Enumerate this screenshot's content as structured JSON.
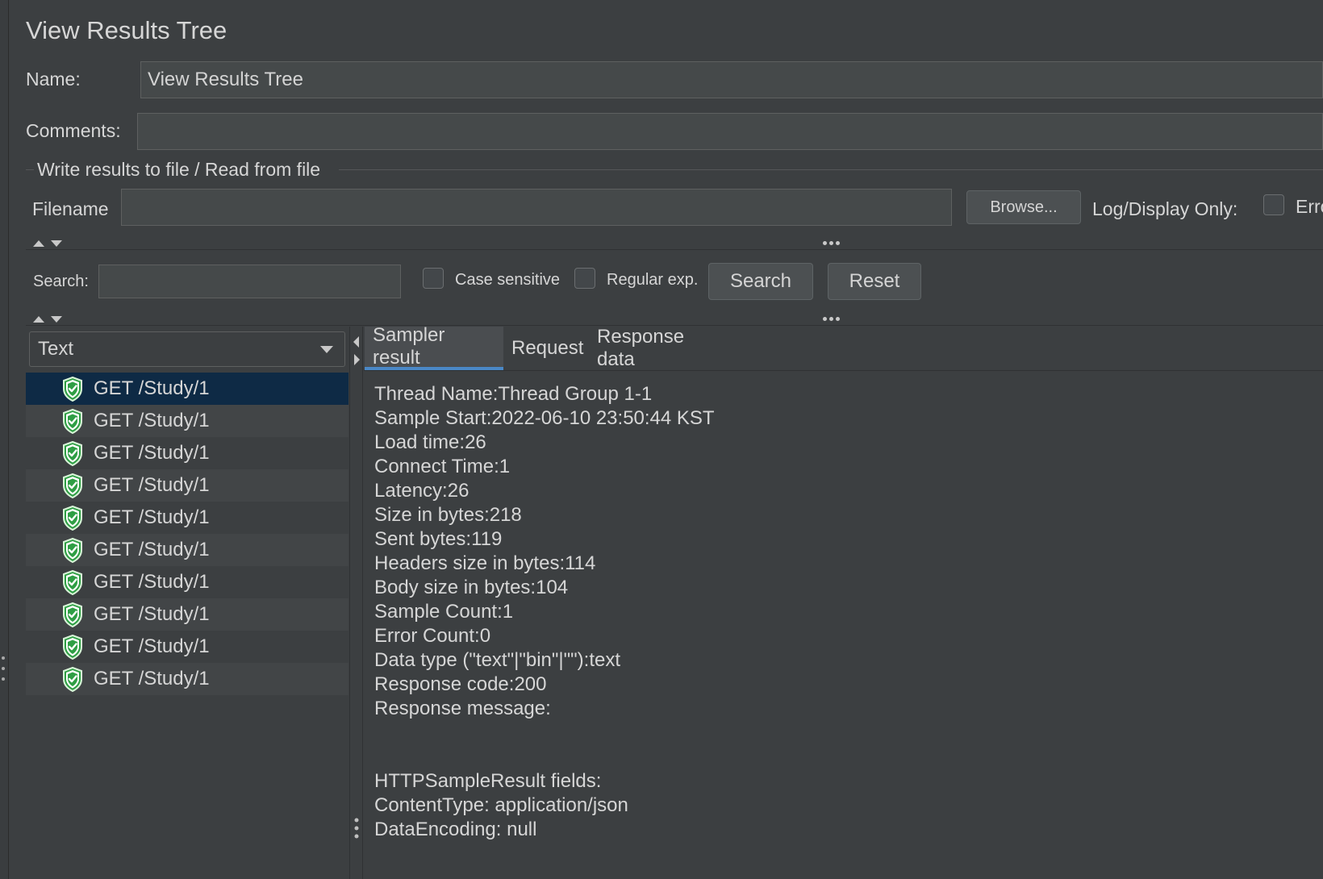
{
  "header": {
    "title": "View Results Tree"
  },
  "form": {
    "name_label": "Name:",
    "name_value": "View Results Tree",
    "comments_label": "Comments:",
    "comments_value": "",
    "file_group_title": "Write results to file / Read from file",
    "filename_label": "Filename",
    "filename_value": "",
    "browse_label": "Browse...",
    "log_display_only_label": "Log/Display Only:",
    "errors_label": "Erro"
  },
  "search": {
    "label": "Search:",
    "value": "",
    "case_sensitive_label": "Case sensitive",
    "regex_label": "Regular exp.",
    "search_button": "Search",
    "reset_button": "Reset"
  },
  "renderer": {
    "selected": "Text"
  },
  "tree": {
    "items": [
      {
        "label": "GET /Study/1",
        "status": "success",
        "selected": true
      },
      {
        "label": "GET /Study/1",
        "status": "success",
        "selected": false
      },
      {
        "label": "GET /Study/1",
        "status": "success",
        "selected": false
      },
      {
        "label": "GET /Study/1",
        "status": "success",
        "selected": false
      },
      {
        "label": "GET /Study/1",
        "status": "success",
        "selected": false
      },
      {
        "label": "GET /Study/1",
        "status": "success",
        "selected": false
      },
      {
        "label": "GET /Study/1",
        "status": "success",
        "selected": false
      },
      {
        "label": "GET /Study/1",
        "status": "success",
        "selected": false
      },
      {
        "label": "GET /Study/1",
        "status": "success",
        "selected": false
      },
      {
        "label": "GET /Study/1",
        "status": "success",
        "selected": false
      }
    ]
  },
  "tabs": [
    {
      "label": "Sampler result",
      "active": true
    },
    {
      "label": "Request",
      "active": false
    },
    {
      "label": "Response data",
      "active": false
    }
  ],
  "sampler_result": {
    "lines": [
      "Thread Name:Thread Group 1-1",
      "Sample Start:2022-06-10 23:50:44 KST",
      "Load time:26",
      "Connect Time:1",
      "Latency:26",
      "Size in bytes:218",
      "Sent bytes:119",
      "Headers size in bytes:114",
      "Body size in bytes:104",
      "Sample Count:1",
      "Error Count:0",
      "Data type (\"text\"|\"bin\"|\"\"):text",
      "Response code:200",
      "Response message:",
      "",
      "",
      "HTTPSampleResult fields:",
      "ContentType: application/json",
      "DataEncoding: null"
    ]
  },
  "colors": {
    "background": "#3c3f41",
    "selected_row": "#0e2a45",
    "tab_accent": "#4a88c7",
    "success_icon": "#3aa14a"
  }
}
